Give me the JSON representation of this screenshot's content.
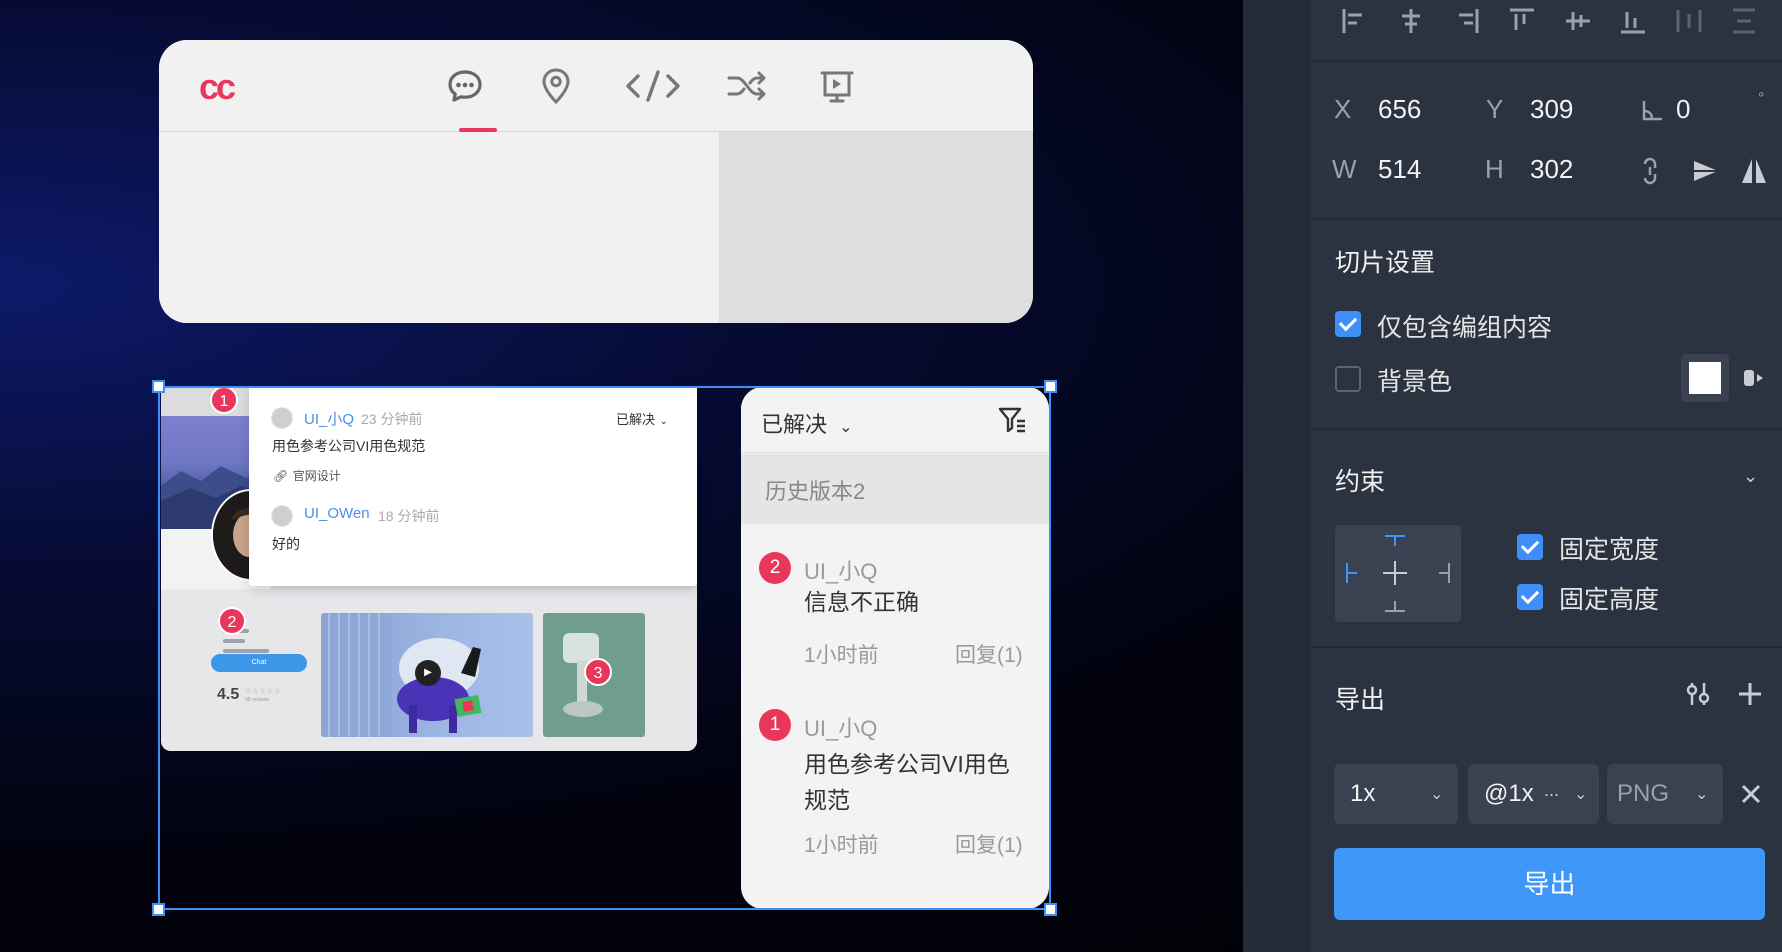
{
  "top_card": {
    "logo": "cc",
    "tabs": [
      "chat",
      "location",
      "code",
      "shuffle",
      "presentation"
    ],
    "active_tab": "chat",
    "accent_color": "#e8375a"
  },
  "preview": {
    "chat_button": "Chat",
    "rating": "4.5",
    "rating_stars": "☆☆☆☆☆",
    "rating_sub": "98 reviews",
    "markers": [
      "1",
      "2",
      "3"
    ]
  },
  "popup": {
    "status": "已解决",
    "comments": [
      {
        "user": "UI_小Q",
        "time": "23 分钟前",
        "text": "用色参考公司VI用色规范",
        "tag": "官网设计"
      },
      {
        "user": "UI_OWen",
        "time": "18 分钟前",
        "text": "好的"
      }
    ]
  },
  "comment_panel": {
    "filter_status": "已解决",
    "version": "历史版本2",
    "items": [
      {
        "num": "2",
        "user": "UI_小Q",
        "msg_line1": "信息不正确",
        "msg_line2": "",
        "time": "1小时前",
        "reply": "回复(1)"
      },
      {
        "num": "1",
        "user": "UI_小Q",
        "msg_line1": "用色参考公司VI用色",
        "msg_line2": "规范",
        "time": "1小时前",
        "reply": "回复(1)"
      }
    ]
  },
  "props": {
    "x_label": "X",
    "x": "656",
    "y_label": "Y",
    "y": "309",
    "angle": "0",
    "angle_unit": "°",
    "w_label": "W",
    "w": "514",
    "h_label": "H",
    "h": "302",
    "slice_title": "切片设置",
    "slice_group_only": "仅包含编组内容",
    "slice_bg": "背景色",
    "constraint_title": "约束",
    "fixed_width": "固定宽度",
    "fixed_height": "固定高度",
    "export_title": "导出",
    "scale": "1x",
    "suffix": "@1x",
    "suffix_more": "...",
    "format": "PNG",
    "export_button": "导出",
    "accent_color": "#3e97f8"
  }
}
